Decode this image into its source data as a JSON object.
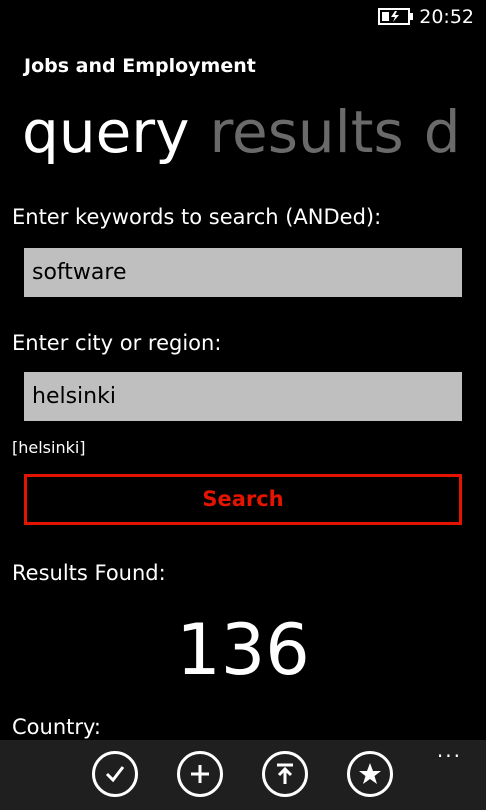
{
  "status_bar": {
    "time": "20:52",
    "icons": [
      "battery-charging-icon"
    ]
  },
  "app": {
    "title": "Jobs and Employment"
  },
  "pivot": {
    "tabs": [
      {
        "label": "query",
        "active": true
      },
      {
        "label": "results",
        "active": false
      },
      {
        "label": "d",
        "active": false
      }
    ]
  },
  "query": {
    "keywords_label": "Enter keywords to search (ANDed):",
    "keywords_value": "software",
    "location_label": "Enter city or region:",
    "location_value": "helsinki",
    "location_note": "[helsinki]",
    "search_label": "Search",
    "results_label": "Results Found:",
    "results_count": "136",
    "country_label": "Country:"
  },
  "app_bar": {
    "buttons": [
      "check-icon",
      "add-icon",
      "upload-icon",
      "favorite-icon"
    ],
    "more": "..."
  },
  "colors": {
    "background": "#000000",
    "accent": "#e51400",
    "inactive_tab": "#6a6a6a",
    "textbox": "#bfbfbf",
    "app_bar": "#1f1f1f"
  }
}
